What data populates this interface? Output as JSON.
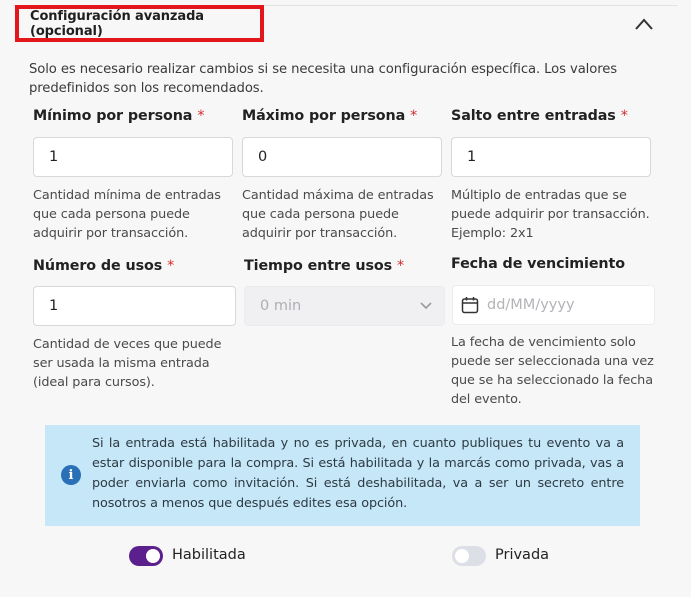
{
  "section": {
    "title": "Configuración avanzada (opcional)",
    "intro": "Solo es necesario realizar cambios si se necesita una configuración específica. Los valores predefinidos son los recomendados."
  },
  "fields": {
    "min": {
      "label": "Mínimo por persona",
      "required": "*",
      "value": "1",
      "help": "Cantidad mínima de entradas que cada persona puede adquirir por transacción."
    },
    "max": {
      "label": "Máximo por persona",
      "required": "*",
      "value": "0",
      "help": "Cantidad máxima de entradas que cada persona puede adquirir por transacción."
    },
    "step": {
      "label": "Salto entre entradas",
      "required": "*",
      "value": "1",
      "help": "Múltiplo de entradas que se puede adquirir por transacción. Ejemplo: 2x1"
    },
    "uses": {
      "label": "Número de usos",
      "required": "*",
      "value": "1",
      "help": "Cantidad de veces que puede ser usada la misma entrada (ideal para cursos)."
    },
    "interval": {
      "label": "Tiempo entre usos",
      "required": "*",
      "value": "0 min"
    },
    "expiry": {
      "label": "Fecha de vencimiento",
      "placeholder": "dd/MM/yyyy",
      "help": "La fecha de vencimiento solo puede ser seleccionada una vez que se ha seleccionado la fecha del evento."
    }
  },
  "info": {
    "text": "Si la entrada está habilitada y no es privada, en cuanto publiques tu evento va a estar disponible para la compra. Si está habilitada y la marcás como privada, vas a poder enviarla como invitación. Si está deshabilitada, va a ser un secreto entre nosotros a menos que después edites esa opción."
  },
  "toggles": {
    "enabled": {
      "label": "Habilitada",
      "on": true
    },
    "private": {
      "label": "Privada",
      "on": false
    }
  },
  "colors": {
    "accent": "#5b1f8e",
    "highlight_border": "#e3161c",
    "info_bg": "#c6e7f7",
    "info_icon": "#2a70b7"
  }
}
